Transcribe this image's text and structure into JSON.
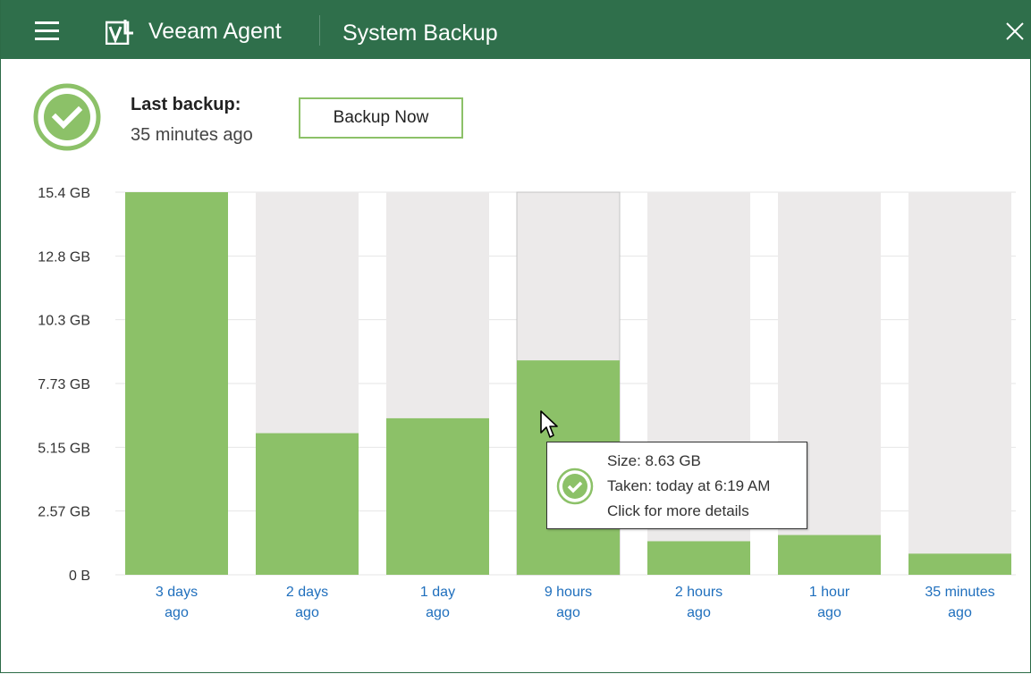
{
  "window": {
    "app_name": "Veeam Agent",
    "page_title": "System Backup",
    "accent_color": "#2f6f4b"
  },
  "icons": {
    "menu": "hamburger-menu-icon",
    "logo": "veeam-logo-icon",
    "close": "close-icon",
    "status": "success-check-icon",
    "cursor": "mouse-pointer-icon"
  },
  "status": {
    "label": "Last backup:",
    "value": "35 minutes ago",
    "state_color": "#8cc168"
  },
  "actions": {
    "backup_now": "Backup Now"
  },
  "chart_data": {
    "type": "bar",
    "y_ticks": [
      "15.4 GB",
      "12.8 GB",
      "10.3 GB",
      "7.73 GB",
      "5.15 GB",
      "2.57 GB",
      "0 B"
    ],
    "ylim": [
      0,
      15.4
    ],
    "unit": "GB",
    "categories": [
      [
        "3 days",
        "ago"
      ],
      [
        "2 days",
        "ago"
      ],
      [
        "1 day",
        "ago"
      ],
      [
        "9 hours",
        "ago"
      ],
      [
        "2 hours",
        "ago"
      ],
      [
        "1 hour",
        "ago"
      ],
      [
        "35 minutes",
        "ago"
      ]
    ],
    "values": [
      15.4,
      5.7,
      6.3,
      8.63,
      1.35,
      1.6,
      0.85
    ],
    "selected_index": 3,
    "bar_color": "#8cc168",
    "track_color": "#eceaea",
    "grid": true
  },
  "tooltip": {
    "size": "Size: 8.63 GB",
    "taken": "Taken: today at 6:19 AM",
    "details": "Click for more details"
  }
}
